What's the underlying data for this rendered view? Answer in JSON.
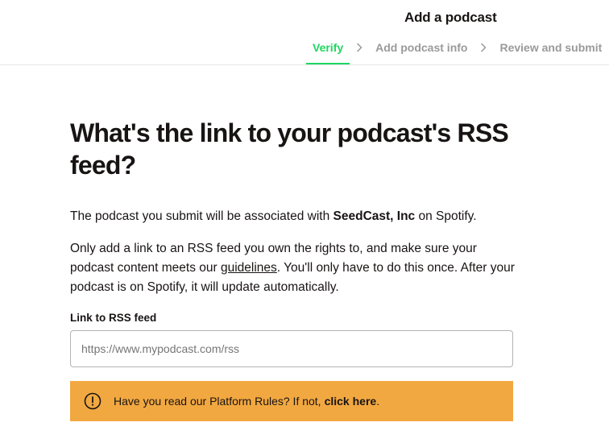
{
  "header": {
    "title": "Add a podcast",
    "steps": [
      {
        "label": "Verify",
        "active": true
      },
      {
        "label": "Add podcast info",
        "active": false
      },
      {
        "label": "Review and submit",
        "active": false
      }
    ],
    "active_color": "#1ed760"
  },
  "main": {
    "title": "What's the link to your podcast's RSS feed?",
    "association": {
      "before": "The podcast you submit will be associated with",
      "company": "SeedCast, Inc",
      "after": "on Spotify."
    },
    "rights": {
      "before": "Only add a link to an RSS feed you own the rights to, and make sure your podcast content meets our",
      "link": "guidelines",
      "after": ". You'll only have to do this once. After your podcast is on Spotify, it will update automatically."
    },
    "rss_field": {
      "label": "Link to RSS feed",
      "placeholder": "https://www.mypodcast.com/rss",
      "value": ""
    }
  },
  "banner": {
    "icon": "warning-circle-icon",
    "text": "Have you read our Platform Rules? If not,",
    "link": "click here",
    "end": ".",
    "color": "#f2a840"
  }
}
